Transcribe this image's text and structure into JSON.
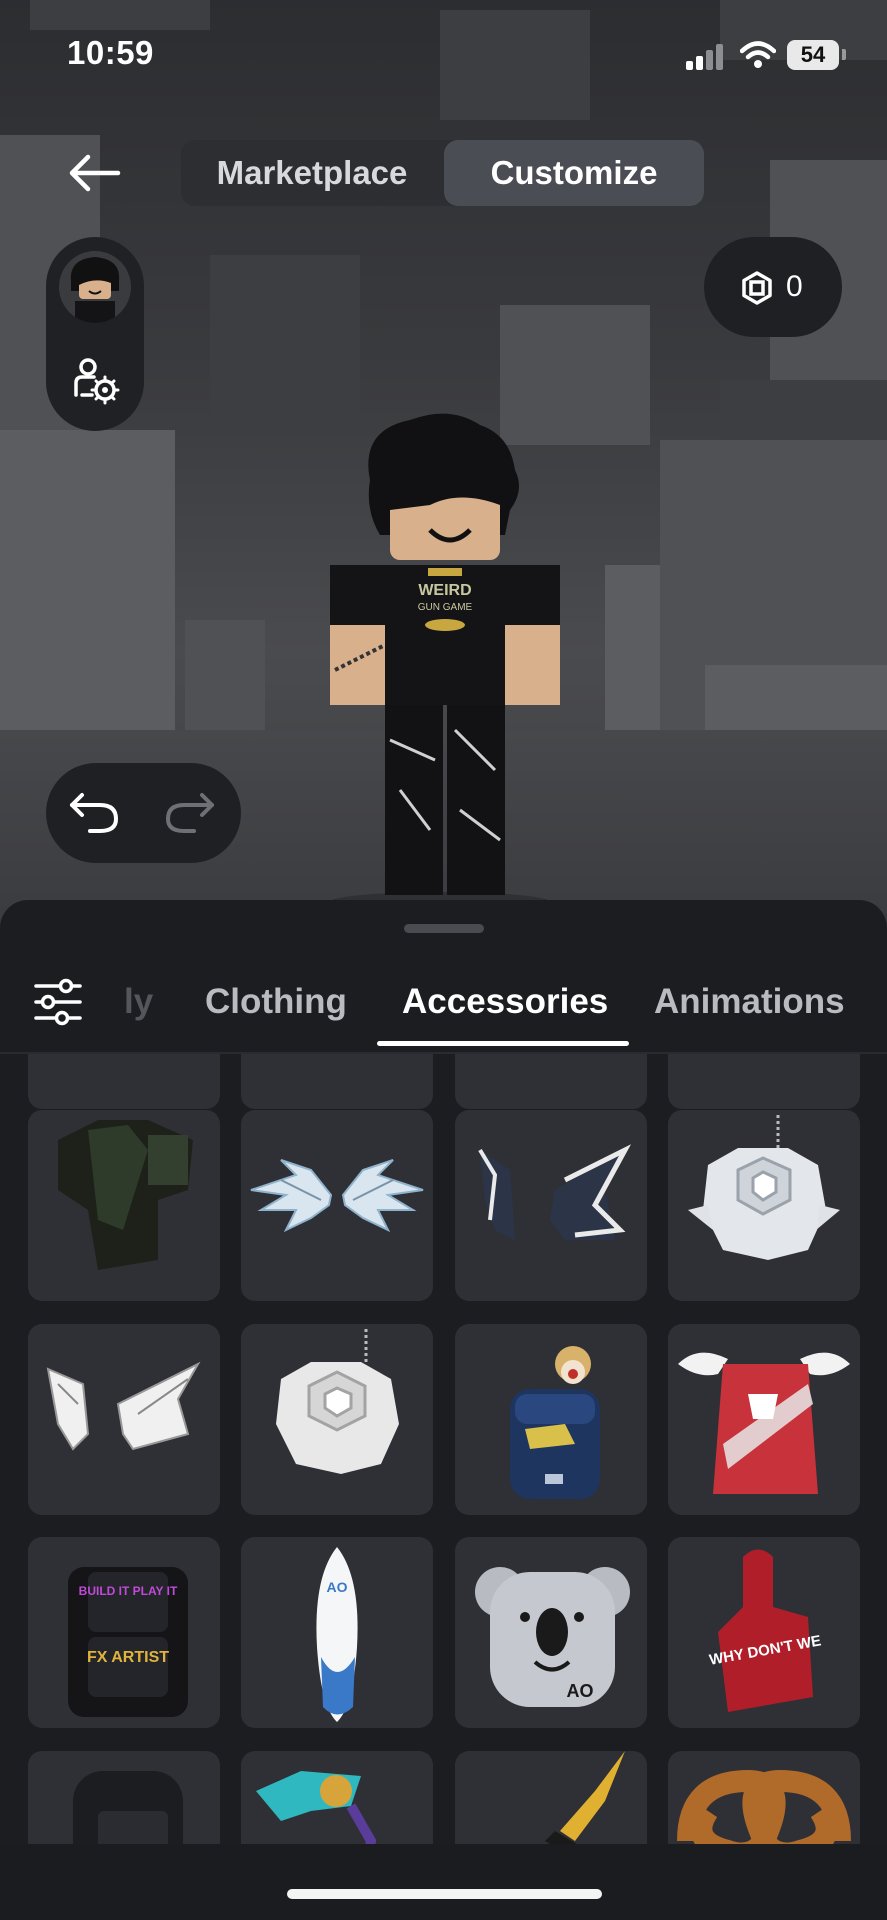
{
  "status_bar": {
    "time": "10:59",
    "battery": "54"
  },
  "nav": {
    "tabs": [
      {
        "label": "Marketplace",
        "active": false
      },
      {
        "label": "Customize",
        "active": true
      }
    ]
  },
  "currency": {
    "icon": "robux-icon",
    "balance": "0"
  },
  "category_tabs": [
    {
      "label": "ly",
      "active": false
    },
    {
      "label": "Clothing",
      "active": false
    },
    {
      "label": "Accessories",
      "active": true
    },
    {
      "label": "Animations",
      "active": false
    }
  ],
  "items": [
    {
      "icon": "dark-armor-accessory"
    },
    {
      "icon": "ice-crystal-wings-accessory"
    },
    {
      "icon": "dark-crystal-wings-accessory"
    },
    {
      "icon": "silver-crest-backpack-accessory"
    },
    {
      "icon": "white-crystal-wings-accessory"
    },
    {
      "icon": "silver-crest-backpack-accessory"
    },
    {
      "icon": "blue-backpack-with-toys-accessory"
    },
    {
      "icon": "red-winged-cape-accessory"
    },
    {
      "icon": "build-it-play-it-backpack-accessory"
    },
    {
      "icon": "surfboard-accessory"
    },
    {
      "icon": "koala-backpack-accessory"
    },
    {
      "icon": "foam-finger-accessory"
    },
    {
      "icon": "dark-backpack-accessory"
    },
    {
      "icon": "blue-dragon-accessory"
    },
    {
      "icon": "gold-sword-accessory"
    },
    {
      "icon": "pretzel-accessory"
    }
  ],
  "item_texts": {
    "fx_artist": "FX ARTIST",
    "build_it": "BUILD IT PLAY IT",
    "surfboard_logo": "AO",
    "koala_logo": "AO",
    "foam_finger": "WHY DON'T WE",
    "shirt_print": "WEIRD GUN GAME"
  },
  "colors": {
    "sheet_bg": "#1c1d21",
    "tile_bg": "#2f3035",
    "active_tab_bg": "#4b4d55"
  }
}
